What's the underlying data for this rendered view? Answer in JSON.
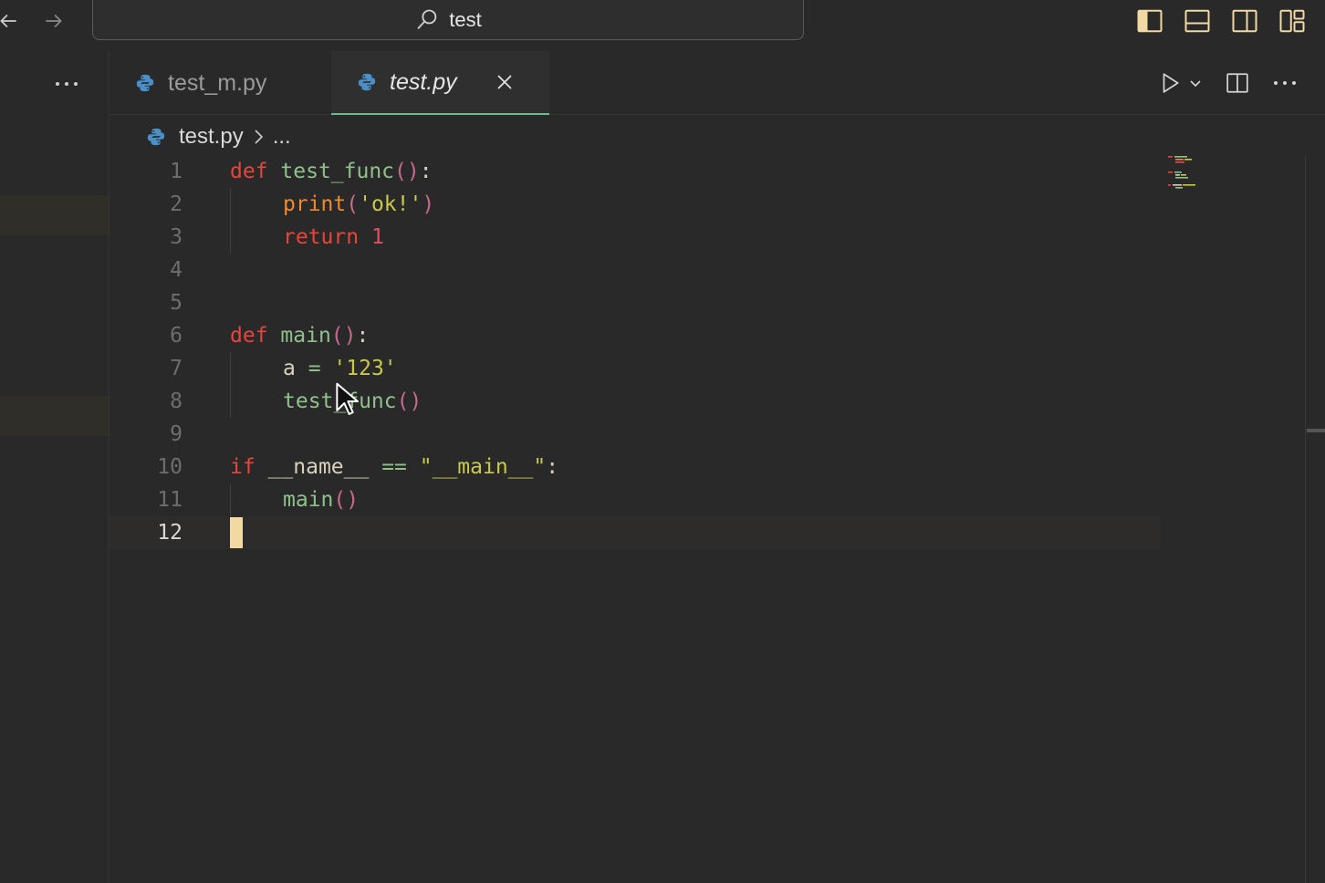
{
  "titlebar": {
    "back_icon": "arrow-left-icon",
    "forward_icon": "arrow-right-icon",
    "search_text": "test",
    "layout_icons": [
      "toggle-primary-sidebar-icon",
      "toggle-panel-icon",
      "toggle-secondary-sidebar-icon",
      "customize-layout-icon"
    ]
  },
  "tabs": [
    {
      "label": "test_m.py",
      "active": false
    },
    {
      "label": "test.py",
      "active": true
    }
  ],
  "editor_actions": [
    "run-icon",
    "run-dropdown-icon",
    "split-editor-icon",
    "more-actions-icon"
  ],
  "breadcrumb": {
    "file": "test.py",
    "rest": "..."
  },
  "lines": [
    {
      "n": "1",
      "indent": 0,
      "tokens": [
        [
          "kw",
          "def"
        ],
        [
          "plain",
          " "
        ],
        [
          "fn",
          "test_func"
        ],
        [
          "paren",
          "()"
        ],
        [
          "plain",
          ":"
        ]
      ]
    },
    {
      "n": "2",
      "indent": 1,
      "tokens": [
        [
          "bi",
          "print"
        ],
        [
          "paren",
          "("
        ],
        [
          "str",
          "'ok!'"
        ],
        [
          "paren",
          ")"
        ]
      ]
    },
    {
      "n": "3",
      "indent": 1,
      "tokens": [
        [
          "kw",
          "return"
        ],
        [
          "plain",
          " "
        ],
        [
          "num",
          "1"
        ]
      ]
    },
    {
      "n": "4",
      "indent": 0,
      "tokens": []
    },
    {
      "n": "5",
      "indent": 0,
      "tokens": []
    },
    {
      "n": "6",
      "indent": 0,
      "tokens": [
        [
          "kw",
          "def"
        ],
        [
          "plain",
          " "
        ],
        [
          "fn",
          "main"
        ],
        [
          "paren",
          "()"
        ],
        [
          "plain",
          ":"
        ]
      ]
    },
    {
      "n": "7",
      "indent": 1,
      "tokens": [
        [
          "plain",
          "a "
        ],
        [
          "op",
          "="
        ],
        [
          "plain",
          " "
        ],
        [
          "str",
          "'123'"
        ]
      ]
    },
    {
      "n": "8",
      "indent": 1,
      "tokens": [
        [
          "fn",
          "test_func"
        ],
        [
          "paren",
          "()"
        ]
      ]
    },
    {
      "n": "9",
      "indent": 0,
      "tokens": []
    },
    {
      "n": "10",
      "indent": 0,
      "tokens": [
        [
          "kw",
          "if"
        ],
        [
          "plain",
          " __name__ "
        ],
        [
          "op",
          "=="
        ],
        [
          "plain",
          " "
        ],
        [
          "str",
          "\"__main__\""
        ],
        [
          "plain",
          ":"
        ]
      ]
    },
    {
      "n": "11",
      "indent": 1,
      "tokens": [
        [
          "fn",
          "main"
        ],
        [
          "paren",
          "()"
        ]
      ]
    },
    {
      "n": "12",
      "indent": 0,
      "tokens": [],
      "current": true
    }
  ],
  "colors": {
    "background": "#292929",
    "keyword": "#e5463c",
    "function": "#8fc08a",
    "string": "#c9c94a",
    "number": "#e04e63",
    "builtin": "#ef8a2e",
    "active_tab_border": "#6fb98f",
    "python_icon": "#4a8fc7"
  }
}
